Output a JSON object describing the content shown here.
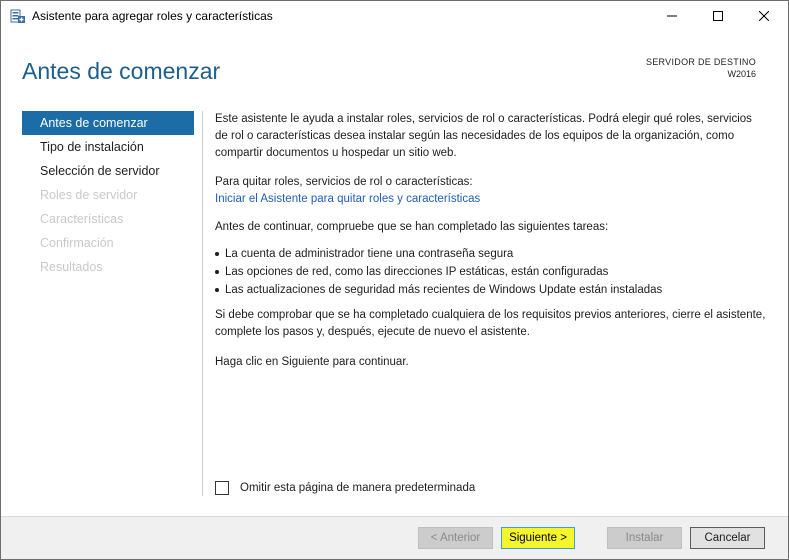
{
  "window": {
    "title": "Asistente para agregar roles y características"
  },
  "header": {
    "title": "Antes de comenzar",
    "destination_label": "SERVIDOR DE DESTINO",
    "destination_value": "W2016"
  },
  "sidebar": {
    "items": [
      {
        "label": "Antes de comenzar",
        "state": "active"
      },
      {
        "label": "Tipo de instalación",
        "state": "enabled"
      },
      {
        "label": "Selección de servidor",
        "state": "enabled"
      },
      {
        "label": "Roles de servidor",
        "state": "disabled"
      },
      {
        "label": "Características",
        "state": "disabled"
      },
      {
        "label": "Confirmación",
        "state": "disabled"
      },
      {
        "label": "Resultados",
        "state": "disabled"
      }
    ]
  },
  "content": {
    "intro": "Este asistente le ayuda a instalar roles, servicios de rol o características. Podrá elegir qué roles, servicios de rol o características desea instalar según las necesidades de los equipos de la organización, como compartir documentos u hospedar un sitio web.",
    "remove_prompt": "Para quitar roles, servicios de rol o características:",
    "remove_link": "Iniciar el Asistente para quitar roles y características",
    "check_prompt": "Antes de continuar, compruebe que se han completado las siguientes tareas:",
    "bullets": [
      "La cuenta de administrador tiene una contraseña segura",
      "Las opciones de red, como las direcciones IP estáticas, están configuradas",
      "Las actualizaciones de seguridad más recientes de Windows Update están instaladas"
    ],
    "prereq_note": "Si debe comprobar que se ha completado cualquiera de los requisitos previos anteriores, cierre el asistente, complete los pasos y, después, ejecute de nuevo el asistente.",
    "continue_note": "Haga clic en Siguiente para continuar."
  },
  "skip_checkbox": {
    "label": "Omitir esta página de manera predeterminada",
    "checked": false
  },
  "footer": {
    "prev_label": "< Anterior",
    "next_label": "Siguiente >",
    "install_label": "Instalar",
    "cancel_label": "Cancelar"
  },
  "colors": {
    "accent": "#1c6ca8",
    "title": "#1c5f8e",
    "link": "#1f5fb7",
    "highlight": "#f5f52c"
  },
  "icons": {
    "app": "server-manager-icon",
    "minimize": "minimize-icon",
    "maximize": "maximize-icon",
    "close": "close-icon",
    "checkbox": "checkbox-icon"
  }
}
